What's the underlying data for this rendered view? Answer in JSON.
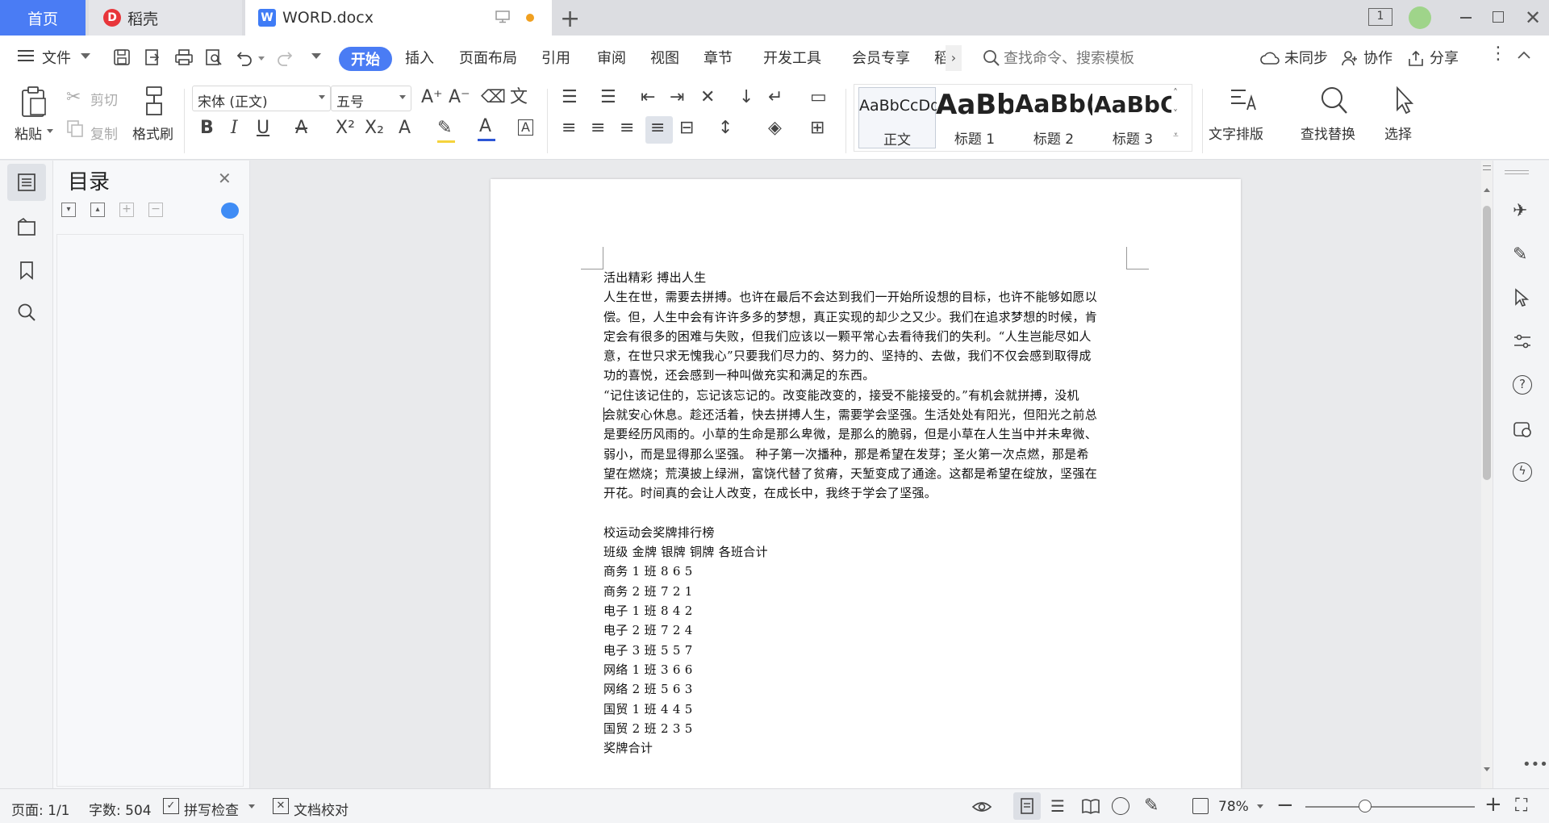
{
  "tabs": {
    "home": "首页",
    "daoke": "稻壳",
    "doc": "WORD.docx"
  },
  "menu": {
    "file": "文件"
  },
  "ribbon_tabs": [
    "开始",
    "插入",
    "页面布局",
    "引用",
    "审阅",
    "视图",
    "章节",
    "开发工具",
    "会员专享",
    "稻"
  ],
  "search": {
    "placeholder": "查找命令、搜索模板"
  },
  "topright": {
    "sync": "未同步",
    "collab": "协作",
    "share": "分享",
    "badge": "1"
  },
  "toolbar": {
    "paste": "粘贴",
    "cut": "剪切",
    "copy": "复制",
    "format_painter": "格式刷",
    "font_name": "宋体 (正文)",
    "font_size": "五号",
    "text_layout": "文字排版",
    "find_replace": "查找替换",
    "select": "选择"
  },
  "styles": [
    {
      "preview": "AaBbCcDd",
      "name": "正文"
    },
    {
      "preview": "AaBb",
      "name": "标题 1"
    },
    {
      "preview": "AaBb(",
      "name": "标题 2"
    },
    {
      "preview": "AaBbC",
      "name": "标题 3"
    }
  ],
  "nav": {
    "title": "目录"
  },
  "document": {
    "lines": [
      "活出精彩  搏出人生",
      "人生在世，需要去拼搏。也许在最后不会达到我们一开始所设想的目标，也许不能够如愿以",
      "偿。但，人生中会有许许多多的梦想，真正实现的却少之又少。我们在追求梦想的时候，肯",
      "定会有很多的困难与失败，但我们应该以一颗平常心去看待我们的失利。“人生岂能尽如人",
      "意，在世只求无愧我心”只要我们尽力的、努力的、坚持的、去做，我们不仅会感到取得成",
      "功的喜悦，还会感到一种叫做充实和满足的东西。",
      "“记住该记住的，忘记该忘记的。改变能改变的，接受不能接受的。”有机会就拼搏，没机",
      "会就安心休息。趁还活着，快去拼搏人生，需要学会坚强。生活处处有阳光，但阳光之前总",
      "是要经历风雨的。小草的生命是那么卑微，是那么的脆弱，但是小草在人生当中并未卑微、",
      "弱小，而是显得那么坚强。 种子第一次播种，那是希望在发芽；圣火第一次点燃，那是希",
      "望在燃烧；荒漠披上绿洲，富饶代替了贫瘠，天堑变成了通途。这都是希望在绽放，坚强在",
      "开花。时间真的会让人改变，在成长中，我终于学会了坚强。",
      "",
      "校运动会奖牌排行榜",
      "班级  金牌  银牌  铜牌  各班合计",
      "商务 1 班  8 6 5",
      "商务 2 班  7 2 1",
      "电子 1 班  8 4 2",
      "电子 2 班  7 2 4",
      "电子 3 班  5 5 7",
      "网络 1 班  3 6 6",
      "网络 2 班  5 6 3",
      "国贸 1 班  4 4 5",
      "国贸 2 班  2 3 5",
      "奖牌合计"
    ]
  },
  "status": {
    "page": "页面: 1/1",
    "words": "字数: 504",
    "spell": "拼写检查",
    "proof": "文档校对",
    "zoom": "78%"
  },
  "colors": {
    "accent": "#4a7cf4",
    "page": "#ffffff",
    "background": "#e9eaec"
  }
}
